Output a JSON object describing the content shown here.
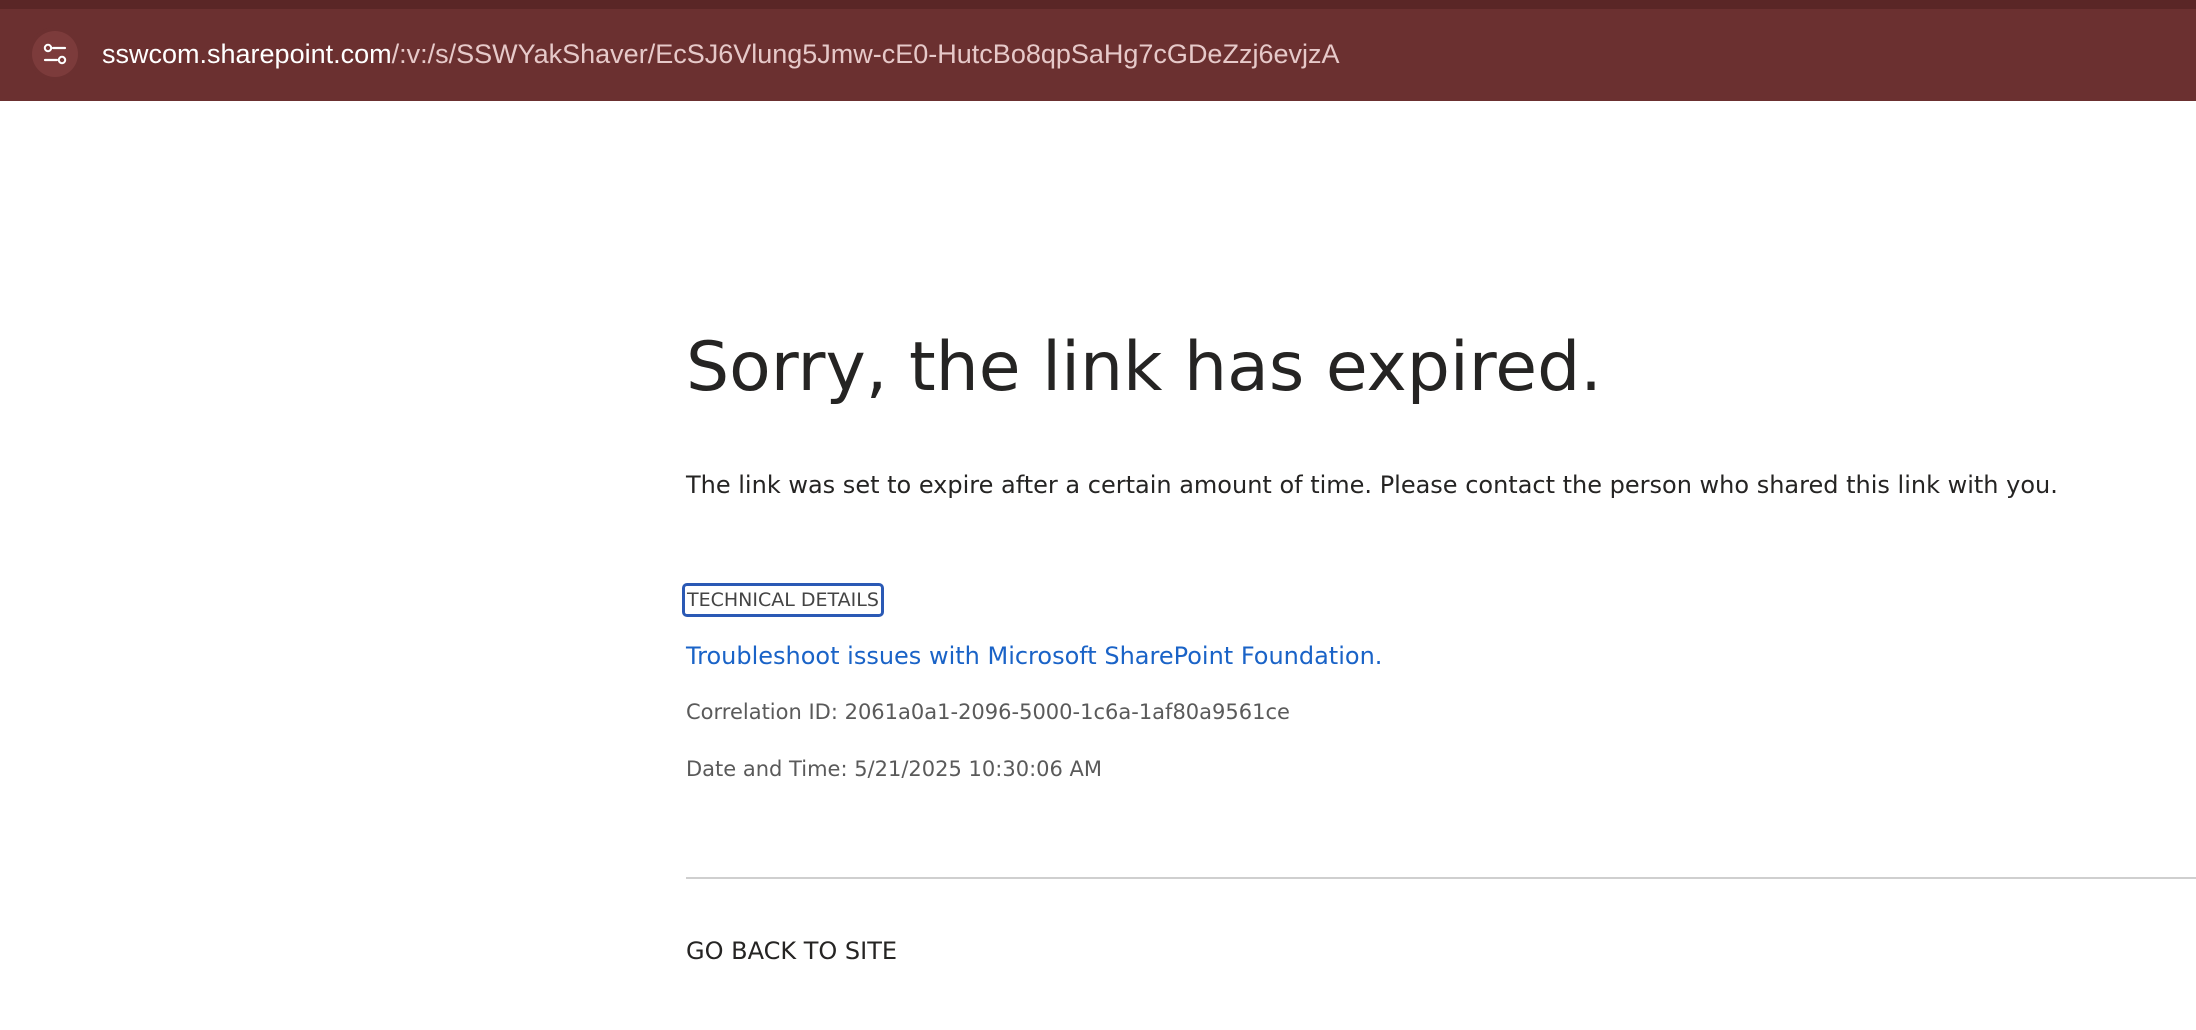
{
  "browser": {
    "url_host": "sswcom.sharepoint.com",
    "url_path": "/:v:/s/SSWYakShaver/EcSJ6Vlung5Jmw-cE0-HutcBo8qpSaHg7cGDeZzj6evjzA",
    "site_info_icon": "tune-icon"
  },
  "error": {
    "title": "Sorry, the link has expired.",
    "message": "The link was set to expire after a certain amount of time. Please contact the person who shared this link with you.",
    "technical_details_label": "TECHNICAL DETAILS",
    "troubleshoot_link": "Troubleshoot issues with Microsoft SharePoint Foundation.",
    "correlation_id": "Correlation ID: 2061a0a1-2096-5000-1c6a-1af80a9561ce",
    "date_time": "Date and Time: 5/21/2025 10:30:06 AM",
    "go_back_label": "GO BACK TO SITE"
  },
  "colors": {
    "browser_bar": "#6b3030",
    "link": "#1a63c7",
    "focus_ring": "#2a59b5",
    "text": "#252423"
  }
}
